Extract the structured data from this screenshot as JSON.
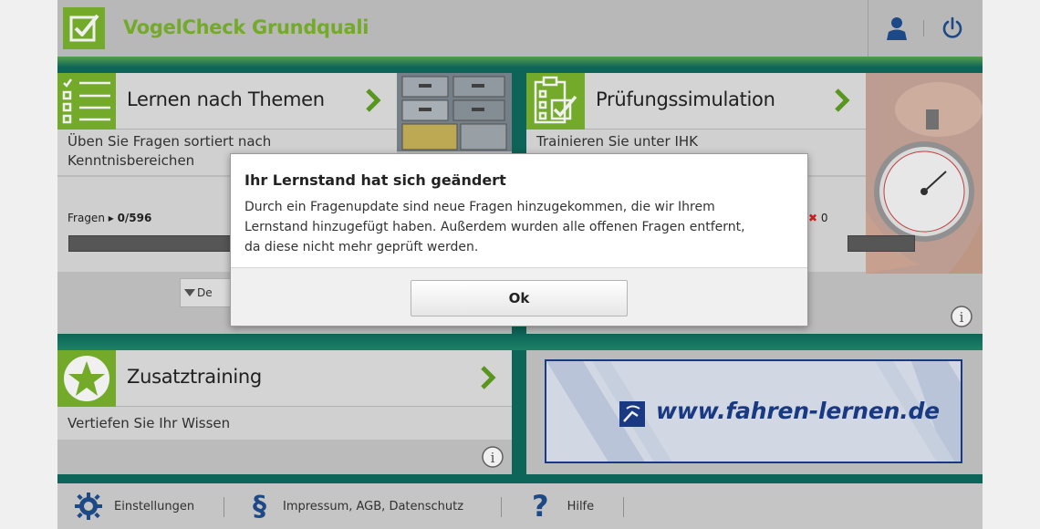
{
  "app": {
    "title": "VogelCheck Grundquali",
    "accent_color": "#7bb52d",
    "background_color": "#0e6b5e"
  },
  "tiles": {
    "learn": {
      "title": "Lernen nach Themen",
      "description_line1": "Üben Sie Fragen sortiert nach",
      "description_line2": "Kenntnisbereichen",
      "progress_label": "Fragen",
      "progress_value": "0/596",
      "dropdown_label": "De"
    },
    "exam": {
      "title": "Prüfungssimulation",
      "description": "Trainieren Sie unter IHK",
      "wrong_count": "0"
    },
    "extra": {
      "title": "Zusatztraining",
      "description": "Vertiefen Sie Ihr Wissen"
    },
    "banner": {
      "url_text": "www.fahren-lernen.de"
    }
  },
  "footer": {
    "settings_label": "Einstellungen",
    "legal_label": "Impressum, AGB, Datenschutz",
    "help_label": "Hilfe"
  },
  "modal": {
    "title": "Ihr Lernstand hat sich geändert",
    "line1": "Durch ein Fragenupdate sind neue Fragen hinzugekommen, die wir Ihrem",
    "line2": "Lernstand hinzugefügt haben. Außerdem wurden alle offenen Fragen entfernt,",
    "line3": "da diese nicht mehr geprüft werden.",
    "ok_label": "Ok"
  },
  "icons": {
    "logo": "checkbox-icon",
    "user": "user-icon",
    "power": "power-icon",
    "learn": "list-icon",
    "exam": "clipboard-check-icon",
    "extra": "star-icon",
    "chevron": "chevron-right-icon",
    "info": "info-icon",
    "settings": "gear-icon",
    "legal": "paragraph-icon",
    "help": "question-icon"
  }
}
